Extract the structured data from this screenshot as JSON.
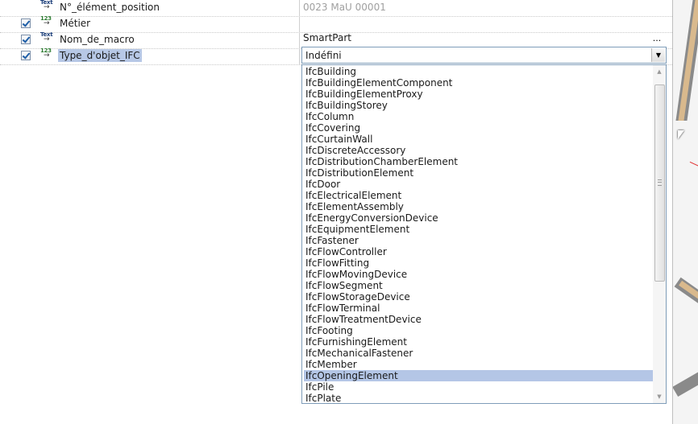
{
  "properties": [
    {
      "icon": "text",
      "icon_label": "Text",
      "name": "N°_élément_position",
      "value": "0023 MaU 00001",
      "checked": false,
      "value_disabled": true
    },
    {
      "icon": "number",
      "icon_label": "123",
      "name": "Métier",
      "value": "",
      "checked": true
    },
    {
      "icon": "text",
      "icon_label": "Text",
      "name": "Nom_de_macro",
      "value": "SmartPart",
      "checked": true,
      "ellipsis": "..."
    },
    {
      "icon": "number",
      "icon_label": "123",
      "name": "Type_d'objet_IFC",
      "value": "Indéfini",
      "checked": true,
      "selected": true
    }
  ],
  "dropdown": {
    "selected": "IfcOpeningElement",
    "items": [
      "IfcBuilding",
      "IfcBuildingElementComponent",
      "IfcBuildingElementProxy",
      "IfcBuildingStorey",
      "IfcColumn",
      "IfcCovering",
      "IfcCurtainWall",
      "IfcDiscreteAccessory",
      "IfcDistributionChamberElement",
      "IfcDistributionElement",
      "IfcDoor",
      "IfcElectricalElement",
      "IfcElementAssembly",
      "IfcEnergyConversionDevice",
      "IfcEquipmentElement",
      "IfcFastener",
      "IfcFlowController",
      "IfcFlowFitting",
      "IfcFlowMovingDevice",
      "IfcFlowSegment",
      "IfcFlowStorageDevice",
      "IfcFlowTerminal",
      "IfcFlowTreatmentDevice",
      "IfcFooting",
      "IfcFurnishingElement",
      "IfcMechanicalFastener",
      "IfcMember",
      "IfcOpeningElement",
      "IfcPile",
      "IfcPlate"
    ]
  },
  "colors": {
    "selection": "#b4c6e6",
    "combo_border": "#7f9db9"
  }
}
